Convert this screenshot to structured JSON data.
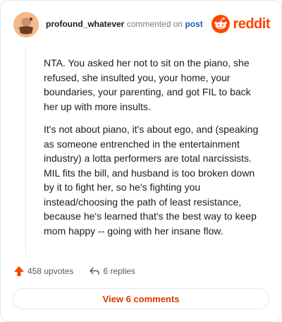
{
  "comment": {
    "author": "profound_whatever",
    "action_text": "commented on",
    "post_link": "post",
    "paragraphs": [
      "NTA. You asked her not to sit on the piano, she refused, she insulted you, your home, your boundaries, your parenting, and got FIL to back her up with more insults.",
      "It's not about piano, it's about ego, and (speaking as someone entrenched in the entertainment industry) a lotta performers are total narcissists. MIL fits the bill, and husband is too broken down by it to fight her, so he's fighting you instead/choosing the path of least resistance, because he's learned that's the best way to keep mom happy -- going with her insane flow."
    ]
  },
  "brand": {
    "name": "reddit",
    "icon": "reddit-logo-icon",
    "color": "#ff4500"
  },
  "actions": {
    "upvotes": "458 upvotes",
    "replies": "6 replies"
  },
  "view_comments_label": "View 6 comments",
  "colors": {
    "accent": "#ff4500",
    "link": "#1a5fb4",
    "button_text": "#d93a00"
  }
}
